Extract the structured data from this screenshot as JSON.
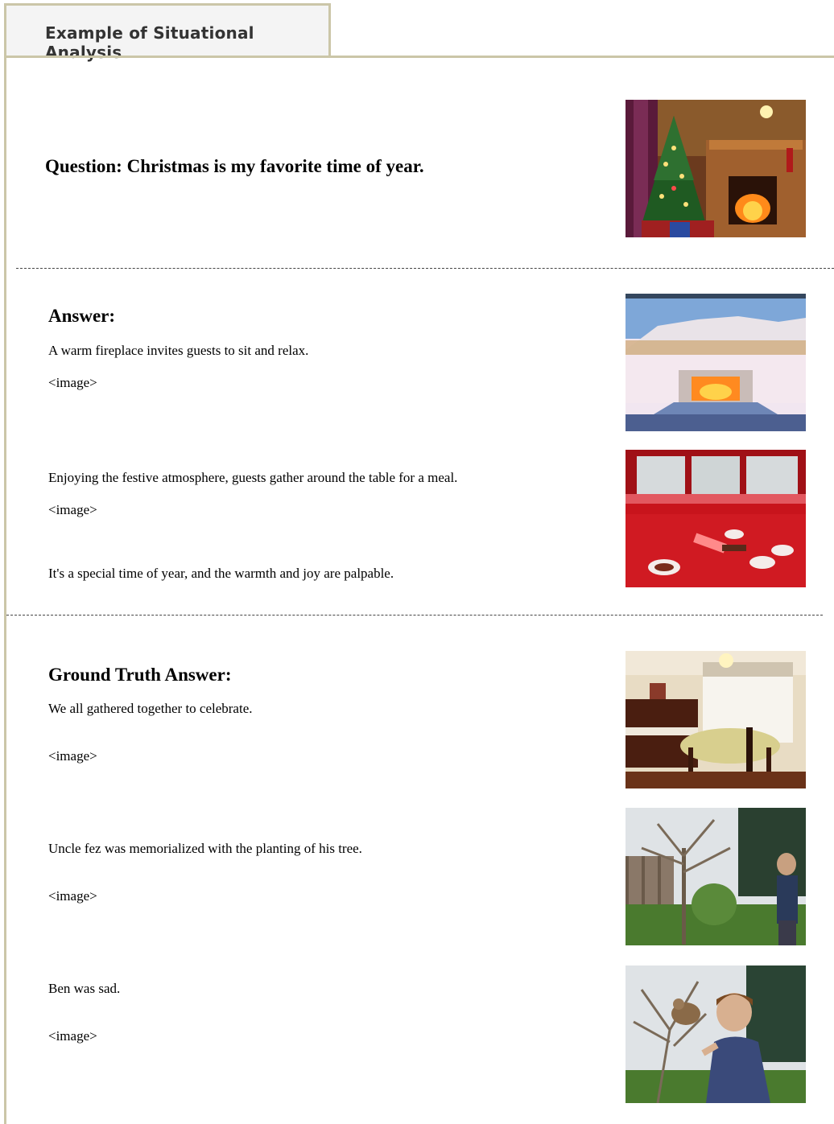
{
  "tab": {
    "label": "Example of Situational Analysis"
  },
  "question": {
    "text": "Question: Christmas is my favorite time of year."
  },
  "answer": {
    "heading": "Answer:",
    "lines": [
      "A warm fireplace invites guests to sit and relax.",
      "<image>",
      "Enjoying the festive atmosphere, guests gather around the table for a meal.",
      "<image>",
      "It's a special time of year, and the warmth and joy are palpable."
    ]
  },
  "ground_truth": {
    "heading": "Ground Truth Answer:",
    "lines": [
      "We all gathered together to celebrate.",
      "<image>",
      "Uncle fez was memorialized with the planting of his tree.",
      "<image>",
      "Ben was sad.",
      "<image>"
    ]
  },
  "colors": {
    "frame": "#cbc6a8",
    "tab_bg": "#f4f4f4"
  }
}
